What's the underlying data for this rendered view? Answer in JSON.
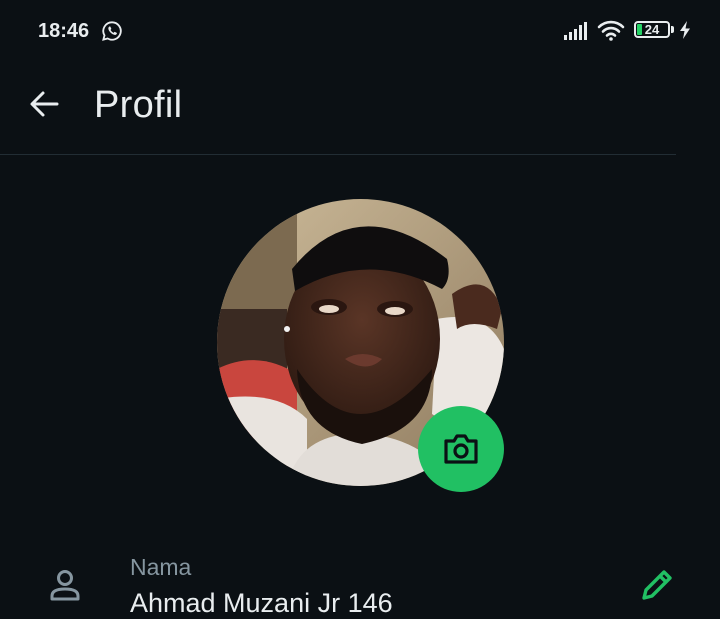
{
  "status_bar": {
    "time": "18:46",
    "battery_level": "24",
    "icons": [
      "whatsapp-icon",
      "signal-icon",
      "wifi-icon",
      "battery-icon",
      "charging-bolt-icon"
    ]
  },
  "header": {
    "title": "Profil",
    "back_icon": "back-arrow-icon"
  },
  "profile": {
    "photo_description": "profile-photo",
    "camera_icon": "camera-icon",
    "name_label": "Nama",
    "name_value": "Ahmad Muzani Jr 146",
    "person_icon": "person-icon",
    "edit_icon": "pencil-icon"
  },
  "colors": {
    "background": "#0b1014",
    "accent": "#21c063",
    "primary_text": "#e9edef",
    "secondary_text": "#8696a0",
    "divider": "#222d34"
  }
}
